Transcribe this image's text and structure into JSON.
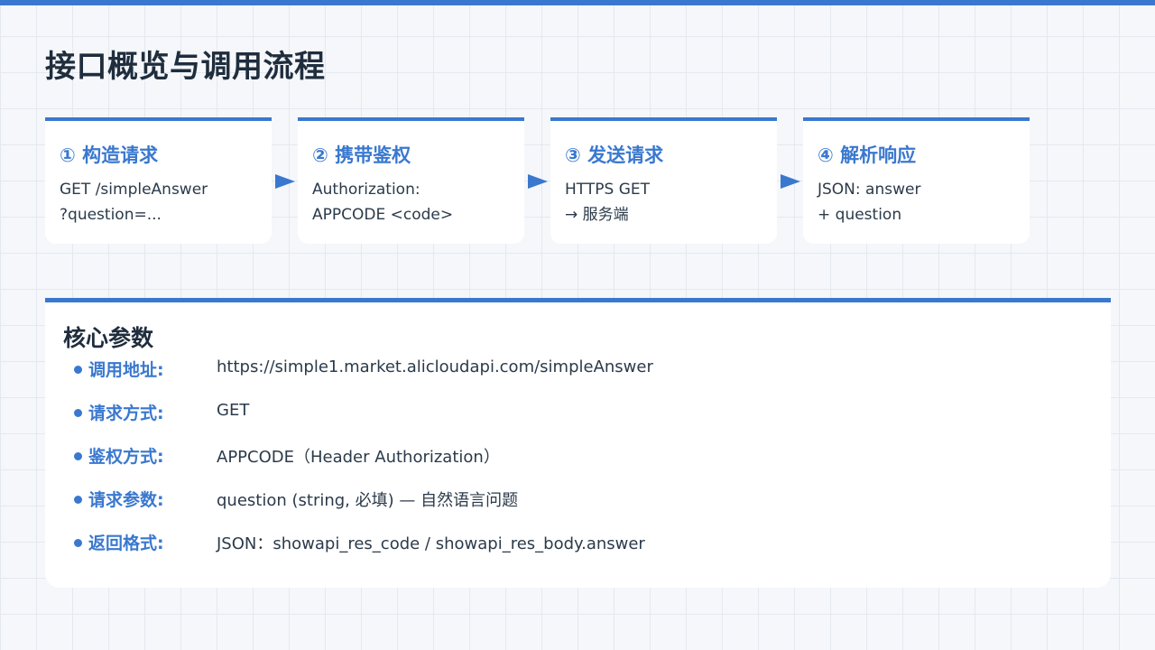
{
  "title": "接口概览与调用流程",
  "steps": [
    {
      "title": "① 构造请求",
      "lines": [
        "GET /simpleAnswer",
        "?question=..."
      ]
    },
    {
      "title": "② 携带鉴权",
      "lines": [
        "Authorization:",
        "APPCODE <code>"
      ]
    },
    {
      "title": "③ 发送请求",
      "lines": [
        "HTTPS GET",
        "→ 服务端"
      ]
    },
    {
      "title": "④ 解析响应",
      "lines": [
        "JSON: answer",
        "+ question"
      ]
    }
  ],
  "params": {
    "title": "核心参数",
    "items": [
      {
        "label": "调用地址:",
        "value": "https://simple1.market.alicloudapi.com/simpleAnswer"
      },
      {
        "label": "请求方式:",
        "value": "GET"
      },
      {
        "label": "鉴权方式:",
        "value": "APPCODE（Header Authorization）"
      },
      {
        "label": "请求参数:",
        "value": "question (string, 必填) — 自然语言问题"
      },
      {
        "label": "返回格式:",
        "value": "JSON：showapi_res_code / showapi_res_body.answer"
      }
    ]
  },
  "colors": {
    "accent": "#3a78cf",
    "text": "#1f2d3d",
    "background": "#f5f7fa"
  },
  "icons": [
    "arrow-right-icon",
    "bullet-dot-icon"
  ]
}
